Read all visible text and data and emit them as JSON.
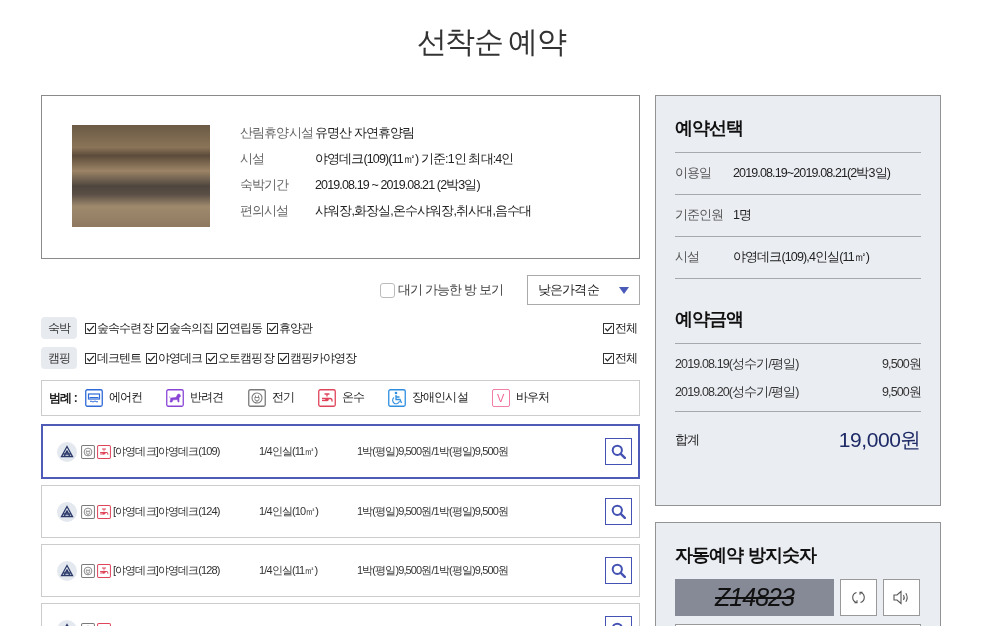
{
  "page": {
    "title": "선착순 예약"
  },
  "facility_card": {
    "fields": [
      {
        "label": "산림휴양시설",
        "value": "유명산 자연휴양림"
      },
      {
        "label": "시설",
        "value": "야영데크(109)(11㎡) 기준:1인 최대:4인"
      },
      {
        "label": "숙박기간",
        "value": "2019.08.19 ~ 2019.08.21 (2박3일)"
      },
      {
        "label": "편의시설",
        "value": "샤워장,화장실,온수샤워장,취사대,음수대"
      }
    ]
  },
  "options": {
    "waitlist": {
      "label": "대기 가능한 방 보기",
      "checked": false
    },
    "sort": {
      "value": "낮은가격순"
    }
  },
  "filters": [
    {
      "category": "숙박",
      "items": [
        {
          "label": "숲속수련장",
          "checked": true
        },
        {
          "label": "숲속의집",
          "checked": true
        },
        {
          "label": "연립동",
          "checked": true
        },
        {
          "label": "휴양관",
          "checked": true
        }
      ],
      "all": {
        "label": "전체",
        "checked": true
      }
    },
    {
      "category": "캠핑",
      "items": [
        {
          "label": "데크텐트",
          "checked": true
        },
        {
          "label": "야영데크",
          "checked": true
        },
        {
          "label": "오토캠핑장",
          "checked": true
        },
        {
          "label": "캠핑카야영장",
          "checked": true
        }
      ],
      "all": {
        "label": "전체",
        "checked": true
      }
    }
  ],
  "legend": {
    "title": "범례 :",
    "items": [
      {
        "kind": "aircon",
        "label": "에어컨"
      },
      {
        "kind": "pet",
        "label": "반려견"
      },
      {
        "kind": "electric",
        "label": "전기"
      },
      {
        "kind": "hot-water",
        "label": "온수"
      },
      {
        "kind": "accessible",
        "label": "장애인시설"
      },
      {
        "kind": "voucher",
        "glyph": "V",
        "label": "바우처"
      }
    ]
  },
  "rooms": [
    {
      "selected": true,
      "amenities": [
        {
          "kind": "electric"
        },
        {
          "kind": "hot-water"
        }
      ],
      "name": "[야영데크]야영데크(109)",
      "size": "1/4인실(11㎡)",
      "price": "1박(평일)9,500원/1박(평일)9,500원"
    },
    {
      "selected": false,
      "amenities": [
        {
          "kind": "electric"
        },
        {
          "kind": "hot-water"
        }
      ],
      "name": "[야영데크]야영데크(124)",
      "size": "1/4인실(10㎡)",
      "price": "1박(평일)9,500원/1박(평일)9,500원"
    },
    {
      "selected": false,
      "amenities": [
        {
          "kind": "electric"
        },
        {
          "kind": "hot-water"
        }
      ],
      "name": "[야영데크]야영데크(128)",
      "size": "1/4인실(11㎡)",
      "price": "1박(평일)9,500원/1박(평일)9,500원"
    },
    {
      "selected": false,
      "amenities": [
        {
          "kind": "electric"
        },
        {
          "kind": "hot-water"
        }
      ]
    }
  ],
  "summary": {
    "title": "예약선택",
    "fields": [
      {
        "label": "이용일",
        "value": "2019.08.19~2019.08.21(2박3일)"
      },
      {
        "label": "기준인원",
        "value": "1명"
      },
      {
        "label": "시설",
        "value": "야영데크(109),4인실(11㎡)"
      }
    ],
    "price_title": "예약금액",
    "prices": [
      {
        "label": "2019.08.19(성수기/평일)",
        "value": "9,500원"
      },
      {
        "label": "2019.08.20(성수기/평일)",
        "value": "9,500원"
      }
    ],
    "total": {
      "label": "합계",
      "value": "19,000원"
    }
  },
  "captcha": {
    "title": "자동예약 방지숫자",
    "code": "Z14823"
  }
}
